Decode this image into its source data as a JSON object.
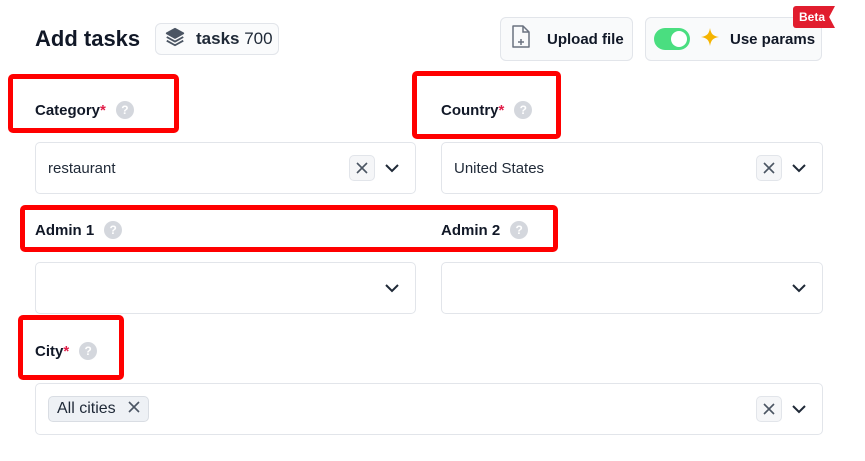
{
  "header": {
    "title": "Add tasks",
    "tasks_label": "tasks",
    "tasks_count": "700",
    "upload_label": "Upload file",
    "params_label": "Use params",
    "beta_badge": "Beta",
    "params_enabled": true
  },
  "fields": {
    "category": {
      "label": "Category",
      "required": "*",
      "value": "restaurant"
    },
    "country": {
      "label": "Country",
      "required": "*",
      "value": "United States"
    },
    "admin1": {
      "label": "Admin 1",
      "value": ""
    },
    "admin2": {
      "label": "Admin 2",
      "value": ""
    },
    "city": {
      "label": "City",
      "required": "*",
      "tag": "All cities"
    }
  },
  "help_glyph": "?",
  "colors": {
    "accent_toggle": "#4ade80",
    "required": "#e11d48",
    "beta": "#e11d2e",
    "highlight": "#ff0000"
  }
}
